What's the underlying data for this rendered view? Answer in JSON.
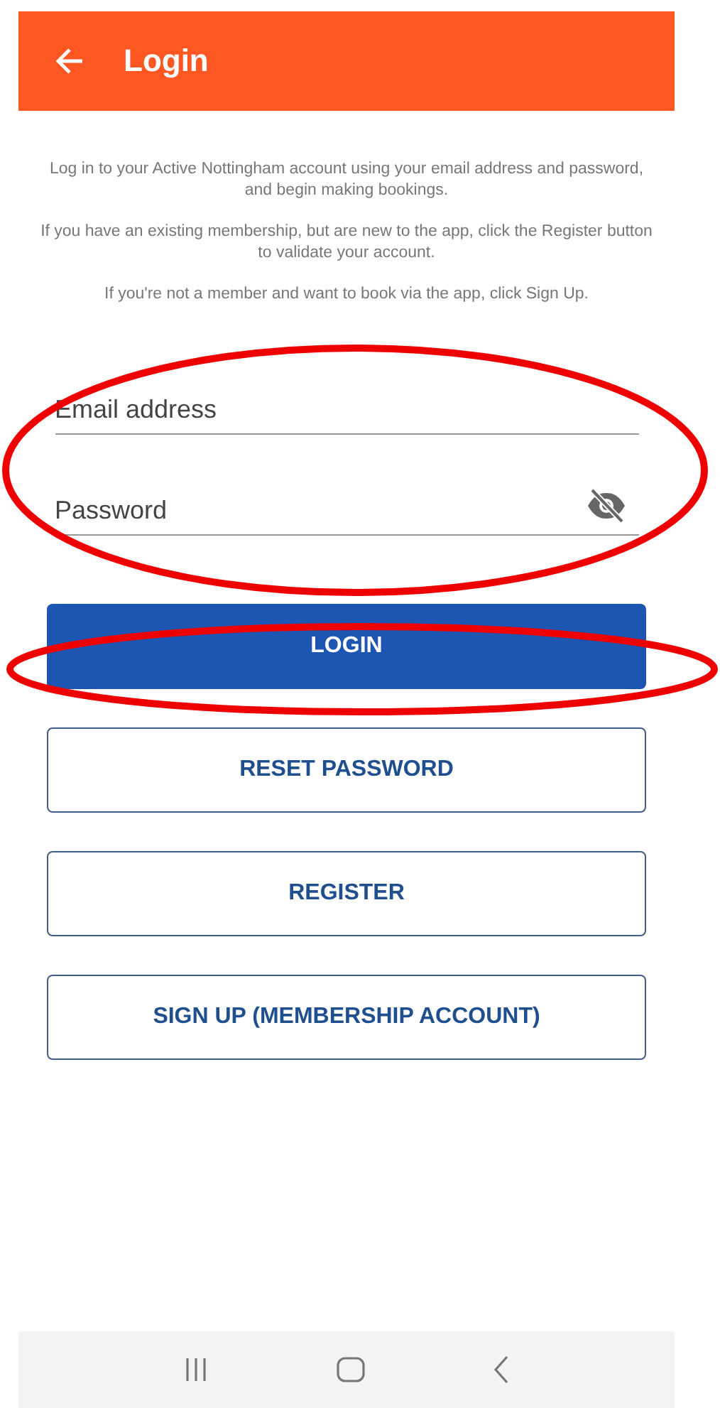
{
  "header": {
    "title": "Login"
  },
  "intro": [
    "Log in to your Active Nottingham account using your email address and password, and begin making bookings.",
    "If you have an existing membership, but are new to the app, click the Register button to validate your account.",
    "If you're not a member and want to book via the app, click Sign Up."
  ],
  "fields": [
    {
      "kind": "email",
      "placeholder": "Email address"
    },
    {
      "kind": "password",
      "placeholder": "Password",
      "revealed": false
    }
  ],
  "buttons": [
    {
      "label": "LOGIN",
      "kind": "primary"
    },
    {
      "label": "RESET PASSWORD",
      "kind": "outline"
    },
    {
      "label": "REGISTER",
      "kind": "outline"
    },
    {
      "label": "SIGN UP (MEMBERSHIP ACCOUNT)",
      "kind": "outline"
    }
  ],
  "annotations": {
    "fields_circled": true,
    "login_circled": true
  }
}
